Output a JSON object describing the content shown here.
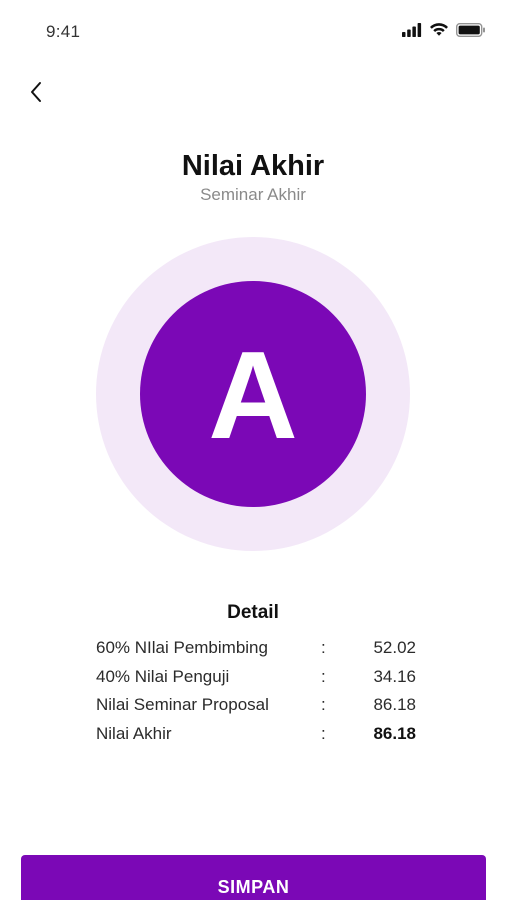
{
  "status_bar": {
    "time": "9:41",
    "icons": [
      "cellular-signal-icon",
      "wifi-icon",
      "battery-icon"
    ]
  },
  "header": {
    "back_icon": "chevron-left-icon",
    "title": "Nilai Akhir",
    "subtitle": "Seminar Akhir"
  },
  "grade": {
    "letter": "A",
    "colors": {
      "outer": "#f3e8f8",
      "inner": "#7b08b6"
    }
  },
  "detail": {
    "heading": "Detail",
    "separator": ":",
    "rows": [
      {
        "label": "60% NIlai Pembimbing",
        "value": "52.02"
      },
      {
        "label": "40% Nilai Penguji",
        "value": "34.16"
      },
      {
        "label": "Nilai Seminar Proposal",
        "value": "86.18"
      },
      {
        "label": "Nilai Akhir",
        "value": "86.18"
      }
    ]
  },
  "actions": {
    "save_label": "SIMPAN",
    "save_color": "#7b08b6"
  }
}
